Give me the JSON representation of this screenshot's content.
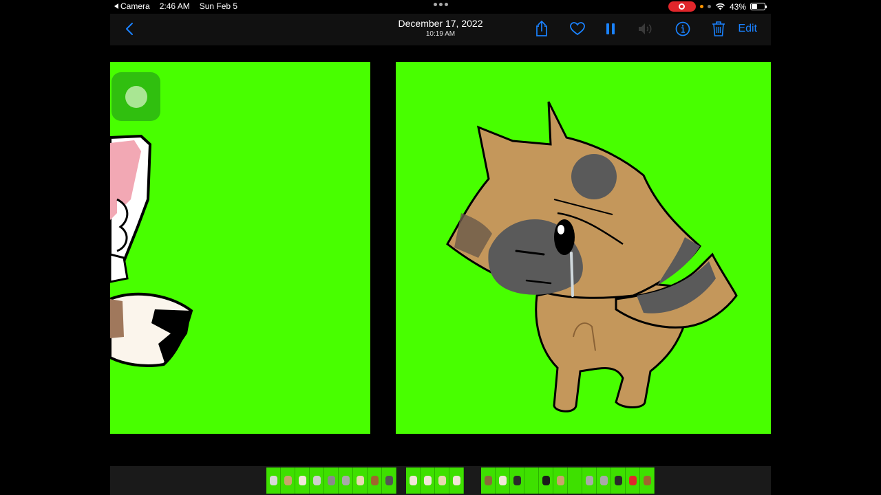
{
  "status_bar": {
    "back_app_label": "Camera",
    "time": "2:46 AM",
    "date": "Sun Feb 5",
    "battery": "43%",
    "battery_level": 0.43
  },
  "toolbar": {
    "date": "December 17, 2022",
    "time": "10:19 AM",
    "edit_label": "Edit"
  },
  "icons": {
    "back": "chevron-left-icon",
    "share": "share-icon",
    "favorite": "heart-icon",
    "pause": "pause-icon",
    "mute": "speaker-icon",
    "info": "info-icon",
    "delete": "trash-icon"
  },
  "colors": {
    "accent": "#1a82ff",
    "green_screen": "#48ff00",
    "recording": "#e0262b"
  },
  "filmstrip": {
    "groups": [
      {
        "count": 9,
        "colors": [
          "#d9d9d9",
          "#caa36c",
          "#f2e6d8",
          "#cfcfcf",
          "#8a8a8a",
          "#a9a9a9",
          "#e8d8b0",
          "#a0642d",
          "#555555"
        ]
      },
      {
        "count": 4,
        "colors": [
          "#f2e6d8",
          "#f2e6d8",
          "#e8d8b0",
          "#f2e6d8"
        ]
      },
      {
        "count": 12,
        "colors": [
          "#8a6a3a",
          "#f2e6d8",
          "#2a2a2a",
          "#3ee000",
          "#1a1a1a",
          "#caa36c",
          "#3ee000",
          "#a9a9a9",
          "#a9a9a9",
          "#2a2a2a",
          "#e0262b",
          "#a0642d"
        ]
      }
    ]
  }
}
